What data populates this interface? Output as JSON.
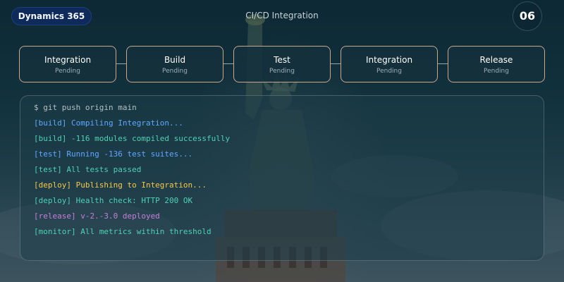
{
  "header": {
    "brand_label": "Dynamics 365",
    "title": "CI/CD Integration",
    "page_number": "06"
  },
  "pipeline": {
    "stages": [
      {
        "name": "Integration",
        "status": "Pending"
      },
      {
        "name": "Build",
        "status": "Pending"
      },
      {
        "name": "Test",
        "status": "Pending"
      },
      {
        "name": "Integration",
        "status": "Pending"
      },
      {
        "name": "Release",
        "status": "Pending"
      }
    ]
  },
  "terminal": {
    "lines": [
      {
        "text": "$ git push origin main",
        "kind": "command"
      },
      {
        "text": "[build] Compiling Integration...",
        "kind": "info"
      },
      {
        "text": "[build] -116 modules compiled successfully",
        "kind": "success"
      },
      {
        "text": "[test] Running -136 test suites...",
        "kind": "info"
      },
      {
        "text": "[test] All tests passed",
        "kind": "success"
      },
      {
        "text": "[deploy] Publishing to Integration...",
        "kind": "warning"
      },
      {
        "text": "[deploy] Health check: HTTP 200 OK",
        "kind": "success"
      },
      {
        "text": "[release] v-2.-3.0 deployed",
        "kind": "release"
      },
      {
        "text": "[monitor] All metrics within threshold",
        "kind": "success"
      }
    ]
  },
  "colors": {
    "brand_pill": "#0e2a5a",
    "stage_border": "#c6a98d",
    "info": "#5fa8ff",
    "success": "#4fd1b5",
    "warning": "#f2c94c",
    "release": "#c57fd8",
    "command": "#b4bfc4"
  },
  "icons": {
    "background": "statue-of-liberty-photo"
  }
}
